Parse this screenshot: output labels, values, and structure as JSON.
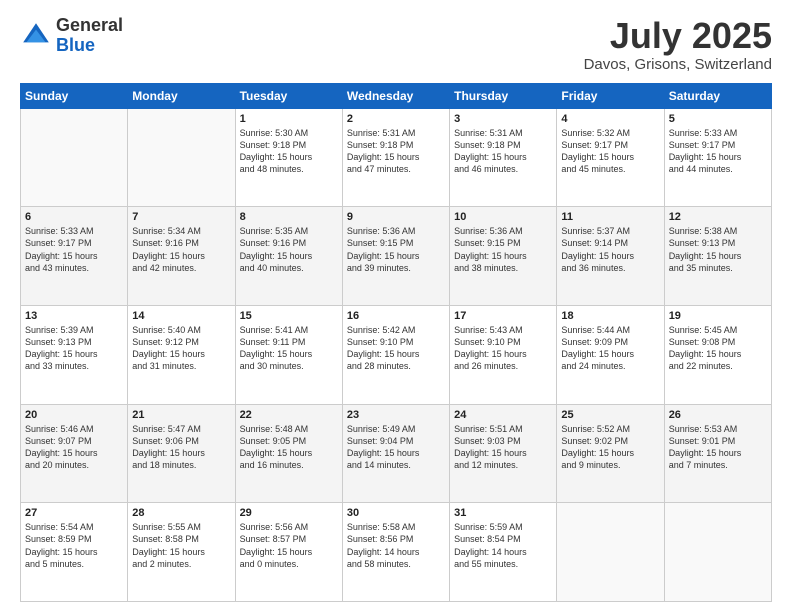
{
  "logo": {
    "general": "General",
    "blue": "Blue"
  },
  "header": {
    "month": "July 2025",
    "location": "Davos, Grisons, Switzerland"
  },
  "days_of_week": [
    "Sunday",
    "Monday",
    "Tuesday",
    "Wednesday",
    "Thursday",
    "Friday",
    "Saturday"
  ],
  "weeks": [
    [
      {
        "day": "",
        "info": ""
      },
      {
        "day": "",
        "info": ""
      },
      {
        "day": "1",
        "info": "Sunrise: 5:30 AM\nSunset: 9:18 PM\nDaylight: 15 hours\nand 48 minutes."
      },
      {
        "day": "2",
        "info": "Sunrise: 5:31 AM\nSunset: 9:18 PM\nDaylight: 15 hours\nand 47 minutes."
      },
      {
        "day": "3",
        "info": "Sunrise: 5:31 AM\nSunset: 9:18 PM\nDaylight: 15 hours\nand 46 minutes."
      },
      {
        "day": "4",
        "info": "Sunrise: 5:32 AM\nSunset: 9:17 PM\nDaylight: 15 hours\nand 45 minutes."
      },
      {
        "day": "5",
        "info": "Sunrise: 5:33 AM\nSunset: 9:17 PM\nDaylight: 15 hours\nand 44 minutes."
      }
    ],
    [
      {
        "day": "6",
        "info": "Sunrise: 5:33 AM\nSunset: 9:17 PM\nDaylight: 15 hours\nand 43 minutes."
      },
      {
        "day": "7",
        "info": "Sunrise: 5:34 AM\nSunset: 9:16 PM\nDaylight: 15 hours\nand 42 minutes."
      },
      {
        "day": "8",
        "info": "Sunrise: 5:35 AM\nSunset: 9:16 PM\nDaylight: 15 hours\nand 40 minutes."
      },
      {
        "day": "9",
        "info": "Sunrise: 5:36 AM\nSunset: 9:15 PM\nDaylight: 15 hours\nand 39 minutes."
      },
      {
        "day": "10",
        "info": "Sunrise: 5:36 AM\nSunset: 9:15 PM\nDaylight: 15 hours\nand 38 minutes."
      },
      {
        "day": "11",
        "info": "Sunrise: 5:37 AM\nSunset: 9:14 PM\nDaylight: 15 hours\nand 36 minutes."
      },
      {
        "day": "12",
        "info": "Sunrise: 5:38 AM\nSunset: 9:13 PM\nDaylight: 15 hours\nand 35 minutes."
      }
    ],
    [
      {
        "day": "13",
        "info": "Sunrise: 5:39 AM\nSunset: 9:13 PM\nDaylight: 15 hours\nand 33 minutes."
      },
      {
        "day": "14",
        "info": "Sunrise: 5:40 AM\nSunset: 9:12 PM\nDaylight: 15 hours\nand 31 minutes."
      },
      {
        "day": "15",
        "info": "Sunrise: 5:41 AM\nSunset: 9:11 PM\nDaylight: 15 hours\nand 30 minutes."
      },
      {
        "day": "16",
        "info": "Sunrise: 5:42 AM\nSunset: 9:10 PM\nDaylight: 15 hours\nand 28 minutes."
      },
      {
        "day": "17",
        "info": "Sunrise: 5:43 AM\nSunset: 9:10 PM\nDaylight: 15 hours\nand 26 minutes."
      },
      {
        "day": "18",
        "info": "Sunrise: 5:44 AM\nSunset: 9:09 PM\nDaylight: 15 hours\nand 24 minutes."
      },
      {
        "day": "19",
        "info": "Sunrise: 5:45 AM\nSunset: 9:08 PM\nDaylight: 15 hours\nand 22 minutes."
      }
    ],
    [
      {
        "day": "20",
        "info": "Sunrise: 5:46 AM\nSunset: 9:07 PM\nDaylight: 15 hours\nand 20 minutes."
      },
      {
        "day": "21",
        "info": "Sunrise: 5:47 AM\nSunset: 9:06 PM\nDaylight: 15 hours\nand 18 minutes."
      },
      {
        "day": "22",
        "info": "Sunrise: 5:48 AM\nSunset: 9:05 PM\nDaylight: 15 hours\nand 16 minutes."
      },
      {
        "day": "23",
        "info": "Sunrise: 5:49 AM\nSunset: 9:04 PM\nDaylight: 15 hours\nand 14 minutes."
      },
      {
        "day": "24",
        "info": "Sunrise: 5:51 AM\nSunset: 9:03 PM\nDaylight: 15 hours\nand 12 minutes."
      },
      {
        "day": "25",
        "info": "Sunrise: 5:52 AM\nSunset: 9:02 PM\nDaylight: 15 hours\nand 9 minutes."
      },
      {
        "day": "26",
        "info": "Sunrise: 5:53 AM\nSunset: 9:01 PM\nDaylight: 15 hours\nand 7 minutes."
      }
    ],
    [
      {
        "day": "27",
        "info": "Sunrise: 5:54 AM\nSunset: 8:59 PM\nDaylight: 15 hours\nand 5 minutes."
      },
      {
        "day": "28",
        "info": "Sunrise: 5:55 AM\nSunset: 8:58 PM\nDaylight: 15 hours\nand 2 minutes."
      },
      {
        "day": "29",
        "info": "Sunrise: 5:56 AM\nSunset: 8:57 PM\nDaylight: 15 hours\nand 0 minutes."
      },
      {
        "day": "30",
        "info": "Sunrise: 5:58 AM\nSunset: 8:56 PM\nDaylight: 14 hours\nand 58 minutes."
      },
      {
        "day": "31",
        "info": "Sunrise: 5:59 AM\nSunset: 8:54 PM\nDaylight: 14 hours\nand 55 minutes."
      },
      {
        "day": "",
        "info": ""
      },
      {
        "day": "",
        "info": ""
      }
    ]
  ]
}
